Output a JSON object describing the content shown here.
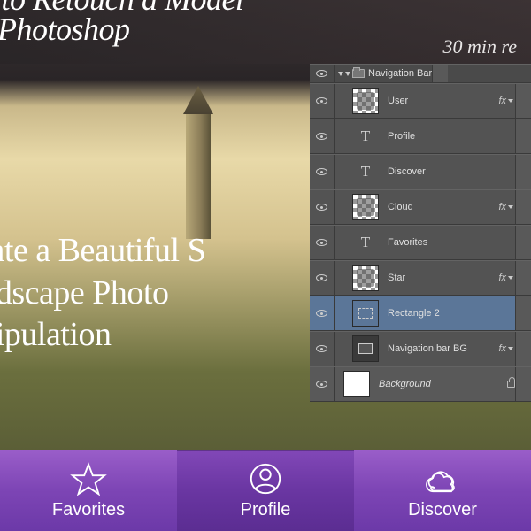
{
  "hero1": {
    "title_line1": "ow to Retouch a Model",
    "title_line2": "ith Photoshop",
    "meta": "30 min re"
  },
  "hero2": {
    "line1": "reate a Beautiful S",
    "line2": "andscape Photo",
    "line3": "anipulation"
  },
  "layers": {
    "group_name": "Navigation Bar",
    "items": [
      {
        "name": "User",
        "fx": true
      },
      {
        "name": "Profile",
        "type": "text"
      },
      {
        "name": "Discover",
        "type": "text"
      },
      {
        "name": "Cloud",
        "fx": true
      },
      {
        "name": "Favorites",
        "type": "text"
      },
      {
        "name": "Star",
        "fx": true
      },
      {
        "name": "Rectangle 2",
        "type": "shape",
        "selected": true
      },
      {
        "name": "Navigation bar BG",
        "type": "shape",
        "fx": true
      }
    ],
    "background": "Background",
    "fx_label": "fx"
  },
  "nav": {
    "items": [
      {
        "label": "Favorites"
      },
      {
        "label": "Profile"
      },
      {
        "label": "Discover"
      }
    ]
  }
}
